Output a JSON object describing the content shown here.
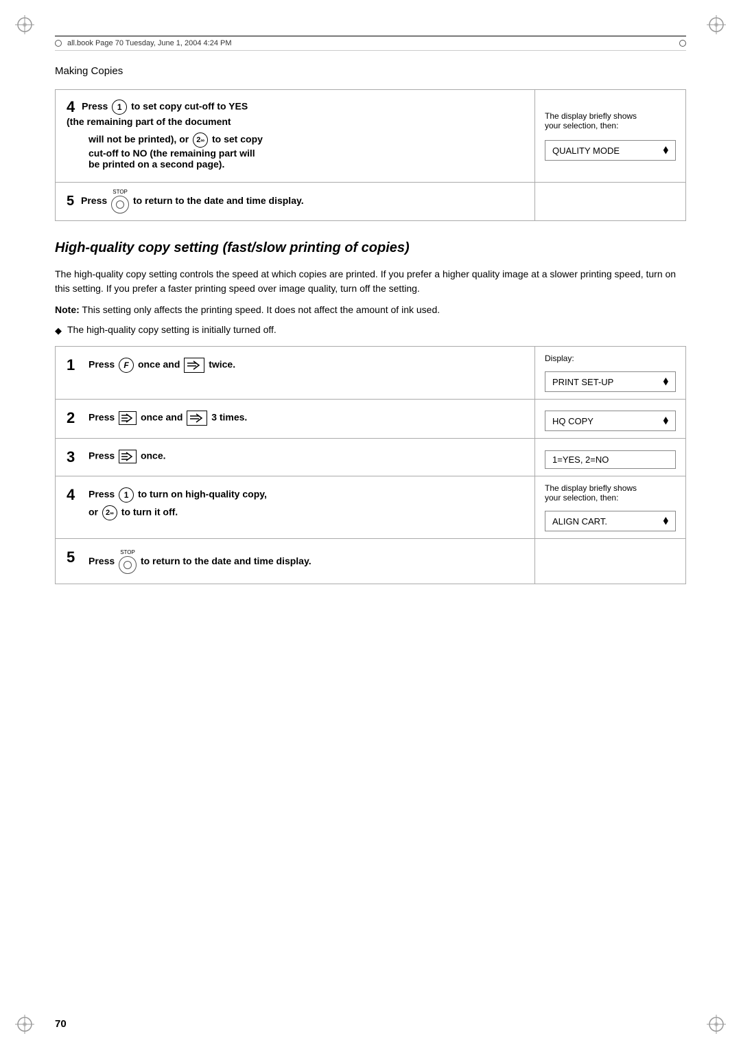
{
  "page": {
    "header": {
      "file_info": "all.book  Page 70  Tuesday, June 1, 2004  4:24 PM"
    },
    "page_title": "Making Copies",
    "page_number": "70",
    "top_section": {
      "step4": {
        "number": "4",
        "text1": "Press",
        "btn1": "1",
        "text2": "to set copy cut-off to YES (the remaining part of the document will not be printed), or",
        "btn2": "2",
        "text3": "to set copy cut-off to NO (the remaining part will be printed on a second page).",
        "display_label": "The display briefly shows your selection, then:",
        "display_text": "QUALITY MODE",
        "display_arrow": "⬧"
      },
      "step5": {
        "number": "5",
        "text1": "Press",
        "text2": "to return to the date and time display."
      }
    },
    "section_heading": "High-quality copy setting (fast/slow printing of copies)",
    "intro_text": "The high-quality copy setting controls the speed at which copies are printed. If you prefer a higher quality image at a slower printing speed, turn on this setting. If you prefer a faster printing speed over image quality, turn off the setting.",
    "note_label": "Note:",
    "note_text": "This setting only affects the printing speed. It does not affect the amount of ink used.",
    "bullet_text": "The high-quality copy setting is initially turned off.",
    "steps": [
      {
        "number": "1",
        "text_before": "Press",
        "btn": "F",
        "text_mid": "once and",
        "text_after": "twice.",
        "display_label": "Display:",
        "display_text": "PRINT SET-UP",
        "display_arrow": "⬧"
      },
      {
        "number": "2",
        "text_before": "Press",
        "text_mid": "once and",
        "text_after": "3 times.",
        "display_label": "",
        "display_text": "HQ COPY",
        "display_arrow": "⬧"
      },
      {
        "number": "3",
        "text_before": "Press",
        "text_after": "once.",
        "display_label": "",
        "display_text": "1=YES, 2=NO",
        "display_arrow": ""
      },
      {
        "number": "4",
        "text_before": "Press",
        "btn1": "1",
        "text_mid": "to turn on high-quality copy,",
        "text_mid2": "or",
        "btn2": "2",
        "text_after": "to turn it off.",
        "display_label": "The display briefly shows your selection, then:",
        "display_text": "ALIGN CART.",
        "display_arrow": "⬧"
      },
      {
        "number": "5",
        "text_before": "Press",
        "text_after": "to return to the date and time display."
      }
    ]
  }
}
